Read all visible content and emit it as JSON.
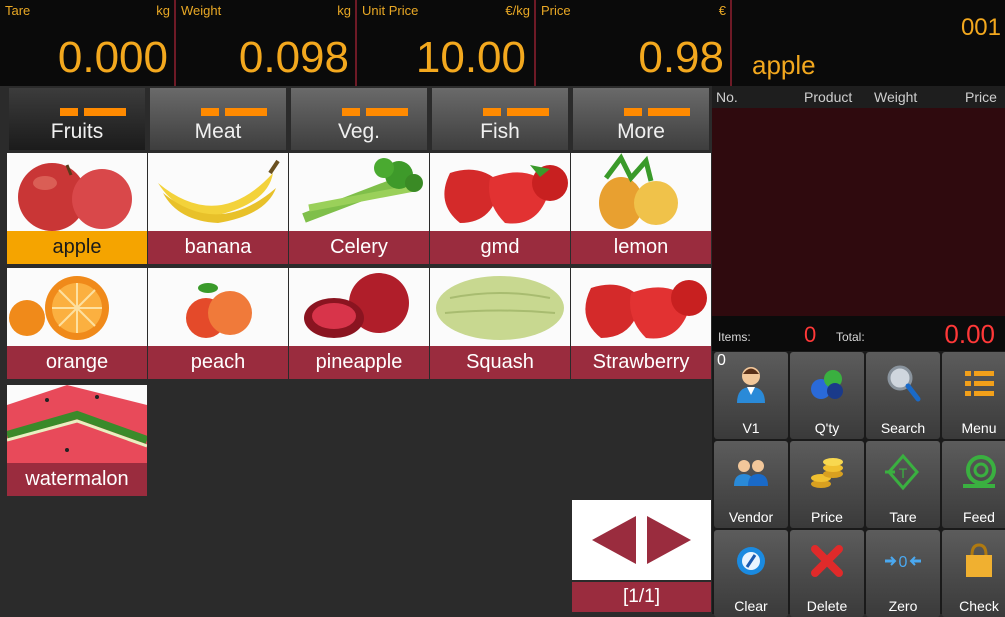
{
  "display": {
    "tare": {
      "label": "Tare",
      "unit": "kg",
      "value": "0.000"
    },
    "weight": {
      "label": "Weight",
      "unit": "kg",
      "value": "0.098"
    },
    "unit_price": {
      "label": "Unit Price",
      "unit": "€/kg",
      "value": "10.00"
    },
    "price": {
      "label": "Price",
      "unit": "€",
      "value": "0.98"
    },
    "product_name": "apple",
    "number": "001"
  },
  "categories": [
    {
      "label": "Fruits",
      "active": true
    },
    {
      "label": "Meat",
      "active": false
    },
    {
      "label": "Veg.",
      "active": false
    },
    {
      "label": "Fish",
      "active": false
    },
    {
      "label": "More",
      "active": false
    }
  ],
  "products": [
    {
      "name": "apple",
      "selected": true,
      "icon": "apple-image"
    },
    {
      "name": "banana",
      "selected": false,
      "icon": "banana-image"
    },
    {
      "name": "Celery",
      "selected": false,
      "icon": "celery-image"
    },
    {
      "name": "gmd",
      "selected": false,
      "icon": "strawberry-image"
    },
    {
      "name": "lemon",
      "selected": false,
      "icon": "pineapple-image"
    },
    {
      "name": "orange",
      "selected": false,
      "icon": "orange-image"
    },
    {
      "name": "peach",
      "selected": false,
      "icon": "peach-image"
    },
    {
      "name": "pineapple",
      "selected": false,
      "icon": "pomegranate-image"
    },
    {
      "name": "Squash",
      "selected": false,
      "icon": "squash-image"
    },
    {
      "name": "Strawberry",
      "selected": false,
      "icon": "strawberry-image"
    },
    {
      "name": "watermalon",
      "selected": false,
      "icon": "watermelon-image"
    }
  ],
  "pagination": {
    "label": "[1/1]"
  },
  "receipt": {
    "columns": [
      "No.",
      "Product",
      "Weight",
      "Price"
    ],
    "items_label": "Items:",
    "items_count": "0",
    "total_label": "Total:",
    "total_value": "0.00"
  },
  "function_keys": [
    {
      "label": "V1",
      "icon": "user-icon",
      "badge": "0"
    },
    {
      "label": "Q'ty",
      "icon": "quantity-icon"
    },
    {
      "label": "Search",
      "icon": "search-icon"
    },
    {
      "label": "Menu",
      "icon": "menu-icon"
    },
    {
      "label": "Vendor",
      "icon": "vendor-icon"
    },
    {
      "label": "Price",
      "icon": "coins-icon"
    },
    {
      "label": "Tare",
      "icon": "tare-icon"
    },
    {
      "label": "Feed",
      "icon": "feed-icon"
    },
    {
      "label": "Clear",
      "icon": "clear-icon"
    },
    {
      "label": "Delete",
      "icon": "delete-icon"
    },
    {
      "label": "Zero",
      "icon": "zero-icon"
    },
    {
      "label": "Check",
      "icon": "shopping-bag-icon"
    }
  ],
  "colors": {
    "accent": "#f3a81e",
    "product_bar": "#9a2c3e",
    "selected": "#f5a400",
    "receipt_bg": "#2f0a0e",
    "total": "#ff3838"
  }
}
